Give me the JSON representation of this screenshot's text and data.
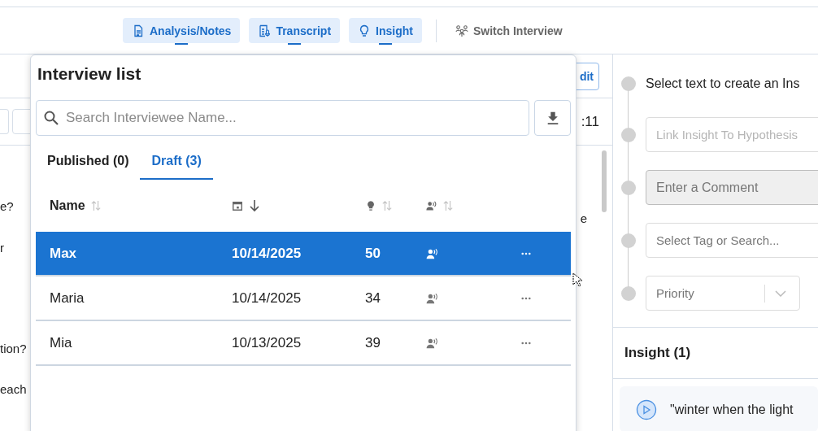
{
  "nav": {
    "tabs": [
      {
        "label": "Analysis/Notes",
        "kind": "notes",
        "on": true
      },
      {
        "label": "Transcript",
        "kind": "transcript",
        "on": true
      },
      {
        "label": "Insight",
        "kind": "insight",
        "on": true
      }
    ],
    "switch_button": "Switch Interview"
  },
  "background": {
    "edit_button": "dit",
    "time": ":11",
    "left_fragments": [
      "e?",
      "r",
      "tion?",
      "each"
    ],
    "right_fragment": "e"
  },
  "popover": {
    "title": "Interview list",
    "search": {
      "placeholder": "Search Interviewee Name..."
    },
    "tabs": [
      {
        "label": "Published (0)",
        "selected": false
      },
      {
        "label": "Draft (3)",
        "selected": true
      }
    ],
    "columns": [
      {
        "kind": "name",
        "label": "Name",
        "sorted": false
      },
      {
        "kind": "date",
        "sorted": true
      },
      {
        "kind": "insights",
        "sorted": false
      },
      {
        "kind": "speaker",
        "sorted": false
      }
    ],
    "rows": [
      {
        "name": "Max",
        "date": "10/14/2025",
        "count": "50",
        "selected": true
      },
      {
        "name": "Maria",
        "date": "10/14/2025",
        "count": "34",
        "selected": false
      },
      {
        "name": "Mia",
        "date": "10/13/2025",
        "count": "39",
        "selected": false
      }
    ]
  },
  "insight_panel": {
    "prompt": "Select text to create an Ins",
    "fields": [
      {
        "kind": "link",
        "placeholder": "Link Insight To Hypothesis"
      },
      {
        "kind": "comment",
        "placeholder": "Enter a Comment"
      },
      {
        "kind": "tag",
        "placeholder": "Select Tag or Search..."
      },
      {
        "kind": "select",
        "placeholder": "Priority"
      }
    ],
    "section_title": "Insight (1)",
    "quote": "\"winter when the light"
  }
}
